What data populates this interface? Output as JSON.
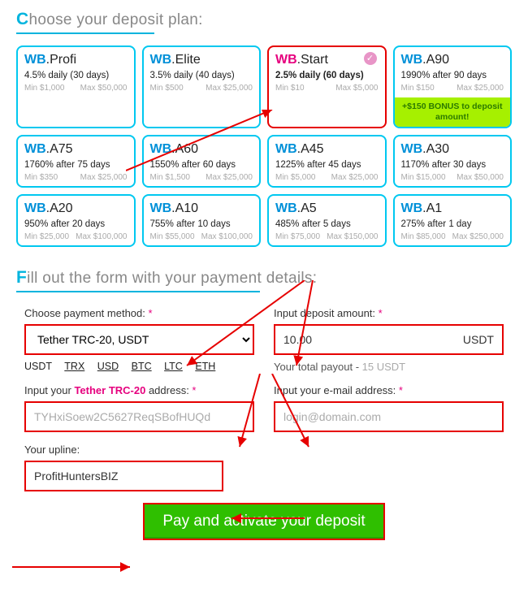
{
  "titles": {
    "choose_first": "C",
    "choose_rest": "hoose your deposit plan:",
    "fill_first": "F",
    "fill_rest": "ill out the form with your payment details:"
  },
  "plans": [
    {
      "wb": "WB",
      "suffix": ".Profi",
      "rate": "4.5% daily (30 days)",
      "min": "Min $1,000",
      "max": "Max $50,000"
    },
    {
      "wb": "WB",
      "suffix": ".Elite",
      "rate": "3.5% daily (40 days)",
      "min": "Min $500",
      "max": "Max $25,000"
    },
    {
      "wb": "WB",
      "suffix": ".Start",
      "rate": "2.5% daily (60 days)",
      "min": "Min $10",
      "max": "Max $5,000",
      "selected": true
    },
    {
      "wb": "WB",
      "suffix": ".A90",
      "rate": "1990% after 90 days",
      "min": "Min $150",
      "max": "Max $25,000",
      "bonus": "+$150 BONUS to deposit amount!"
    },
    {
      "wb": "WB",
      "suffix": ".A75",
      "rate": "1760% after 75 days",
      "min": "Min $350",
      "max": "Max $25,000"
    },
    {
      "wb": "WB",
      "suffix": ".A60",
      "rate": "1550% after 60 days",
      "min": "Min $1,500",
      "max": "Max $25,000"
    },
    {
      "wb": "WB",
      "suffix": ".A45",
      "rate": "1225% after 45 days",
      "min": "Min $5,000",
      "max": "Max $25,000"
    },
    {
      "wb": "WB",
      "suffix": ".A30",
      "rate": "1170% after 30 days",
      "min": "Min $15,000",
      "max": "Max $50,000"
    },
    {
      "wb": "WB",
      "suffix": ".A20",
      "rate": "950% after 20 days",
      "min": "Min $25,000",
      "max": "Max $100,000"
    },
    {
      "wb": "WB",
      "suffix": ".A10",
      "rate": "755% after 10 days",
      "min": "Min $55,000",
      "max": "Max $100,000"
    },
    {
      "wb": "WB",
      "suffix": ".A5",
      "rate": "485% after 5 days",
      "min": "Min $75,000",
      "max": "Max $150,000"
    },
    {
      "wb": "WB",
      "suffix": ".A1",
      "rate": "275% after 1 day",
      "min": "Min $85,000",
      "max": "Max $250,000"
    }
  ],
  "form": {
    "method_label": "Choose payment method: ",
    "method_value": "Tether TRC-20, USDT",
    "amount_label": "Input deposit amount: ",
    "amount_value": "10.00",
    "amount_currency": "USDT",
    "coins": [
      "USDT",
      "TRX",
      "USD",
      "BTC",
      "LTC",
      "ETH"
    ],
    "payout_label": "Your total payout - ",
    "payout_value": "15 USDT",
    "address_label_pre": "Input your ",
    "address_label_tether": "Tether TRC-20",
    "address_label_post": " address: ",
    "address_placeholder": "TYHxiSoew2C5627ReqSBofHUQd",
    "email_label": "Input your e-mail address: ",
    "email_placeholder": "login@domain.com",
    "upline_label": "Your upline:",
    "upline_value": "ProfitHuntersBIZ",
    "req": "*"
  },
  "button": "Pay and activate your deposit",
  "icons": {
    "check": "✓"
  }
}
